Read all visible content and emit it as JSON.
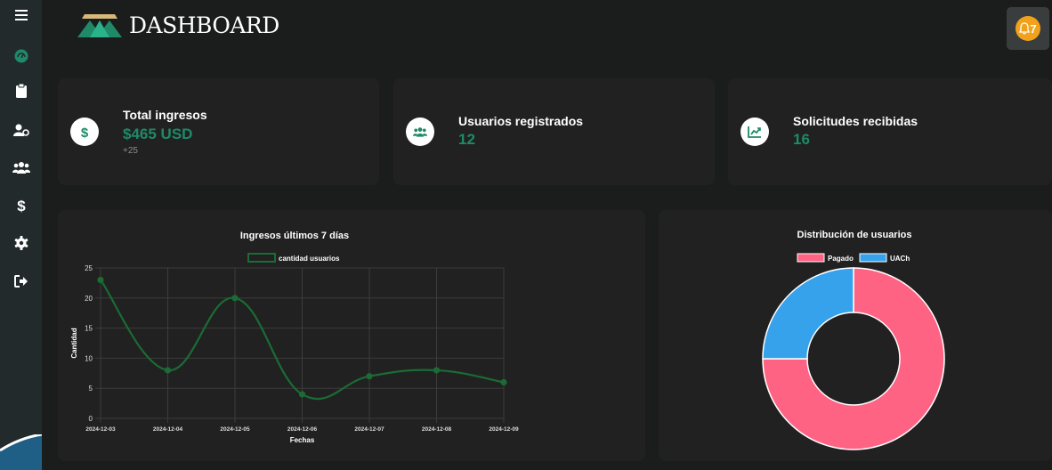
{
  "header": {
    "title": "DASHBOARD",
    "notification_count": "7"
  },
  "sidebar": {
    "items": [
      {
        "icon": "menu-icon"
      },
      {
        "icon": "dashboard-icon"
      },
      {
        "icon": "clipboard-icon"
      },
      {
        "icon": "user-settings-icon"
      },
      {
        "icon": "users-icon"
      },
      {
        "icon": "dollar-icon"
      },
      {
        "icon": "gear-icon"
      },
      {
        "icon": "logout-icon"
      }
    ]
  },
  "stats": [
    {
      "label": "Total ingresos",
      "value": "$465 USD",
      "delta": "+25",
      "icon": "dollar-icon"
    },
    {
      "label": "Usuarios registrados",
      "value": "12",
      "icon": "users-icon"
    },
    {
      "label": "Solicitudes recibidas",
      "value": "16",
      "icon": "chart-line-icon"
    }
  ],
  "colors": {
    "accent": "#1e8a68",
    "line": "#1b6b35",
    "pagado": "#ff6384",
    "uach": "#36a2eb",
    "notification": "#f2a21a"
  },
  "chart_data": [
    {
      "type": "line",
      "title": "Ingresos últimos 7 días",
      "xlabel": "Fechas",
      "ylabel": "Cantidad",
      "categories": [
        "2024-12-03",
        "2024-12-04",
        "2024-12-05",
        "2024-12-06",
        "2024-12-07",
        "2024-12-08",
        "2024-12-09"
      ],
      "series": [
        {
          "name": "cantidad usuarios",
          "values": [
            23,
            8,
            20,
            4,
            7,
            8,
            6
          ]
        }
      ],
      "ylim": [
        0,
        25
      ],
      "yticks": [
        0,
        5,
        10,
        15,
        20,
        25
      ],
      "grid": true,
      "legend": "top"
    },
    {
      "type": "pie",
      "title": "Distribución de usuarios",
      "labels": [
        "Pagado",
        "UACh"
      ],
      "values": [
        75,
        25
      ],
      "donut": true,
      "legend": "top"
    }
  ]
}
